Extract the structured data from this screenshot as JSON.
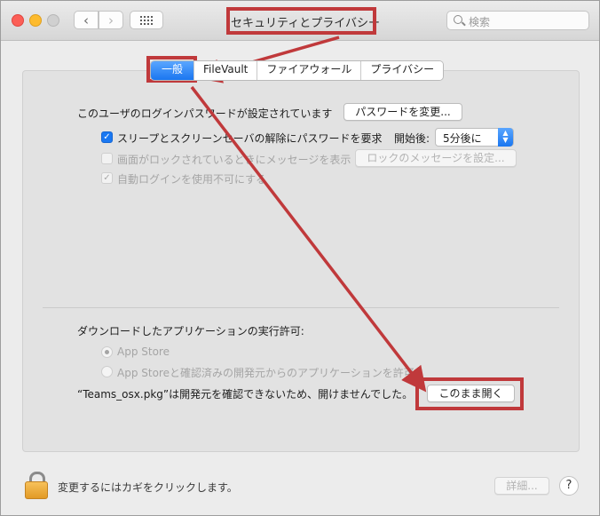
{
  "window": {
    "title": "セキュリティとプライバシー",
    "search_placeholder": "検索"
  },
  "tabs": [
    {
      "label": "一般",
      "active": true
    },
    {
      "label": "FileVault",
      "active": false
    },
    {
      "label": "ファイアウォール",
      "active": false
    },
    {
      "label": "プライバシー",
      "active": false
    }
  ],
  "general": {
    "password_set_text": "このユーザのログインパスワードが設定されています",
    "change_password_button": "パスワードを変更...",
    "require_password_label": "スリープとスクリーンセーバの解除にパスワードを要求",
    "require_password_checked": true,
    "after_label": "開始後:",
    "after_value": "5分後に",
    "show_message_label": "画面がロックされているときにメッセージを表示",
    "show_message_checked": false,
    "set_lock_message_button": "ロックのメッセージを設定...",
    "disable_auto_login_label": "自動ログインを使用不可にする",
    "disable_auto_login_checked": true
  },
  "downloads": {
    "heading": "ダウンロードしたアプリケーションの実行許可:",
    "options": [
      {
        "label": "App Store",
        "selected": true
      },
      {
        "label": "App Storeと確認済みの開発元からのアプリケーションを許可",
        "selected": false
      }
    ],
    "blocked_message": "“Teams_osx.pkg”は開発元を確認できないため、開けませんでした。",
    "open_anyway_button": "このまま開く"
  },
  "footer": {
    "lock_text": "変更するにはカギをクリックします。",
    "advanced_button": "詳細...",
    "help_label": "?"
  },
  "colors": {
    "accent": "#1a76f0",
    "annotation": "#c0393b"
  }
}
